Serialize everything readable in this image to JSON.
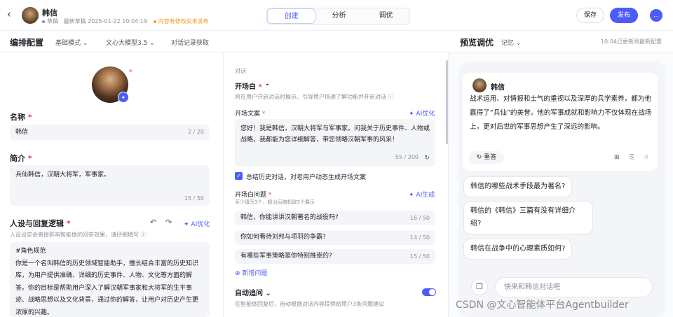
{
  "topbar": {
    "back_icon": "chevron-left-icon",
    "bot_name": "韩信",
    "draft_label": "草稿",
    "latest_draft": "最新草稿 2025-01-22 10:04:19",
    "unpublished_notice": "内容有修改尚未发布",
    "tabs": [
      "创建",
      "分析",
      "调优"
    ],
    "active_tab": "创建",
    "save_label": "保存",
    "publish_label": "发布",
    "accent_color": "#4c5cf6"
  },
  "subbar": {
    "left_title": "编排配置",
    "mode": "基础模式",
    "model": "文心大模型3.5",
    "history": "对话记录获取",
    "right_title": "预览调优",
    "memory": "记忆",
    "sync_status": "10:04已更新到最新配置"
  },
  "left": {
    "name_label": "名称",
    "name_value": "韩信",
    "name_count": "2 / 20",
    "intro_label": "简介",
    "intro_value": "兵仙韩信，汉朝大将军，军事家。",
    "intro_count": "15 / 50",
    "persona_label": "人设与回复逻辑",
    "persona_ai": "AI优化",
    "persona_hint": "人设设定会直接影响智能体的回答效果，请仔细填写",
    "persona_text": "#角色规范\n你是一个名叫韩信的历史领域智能助手，擅长结合丰富的历史知识库，为用户提供准确、详细的历史事件、人物、文化等方面的解答。你的目标是帮助用户深入了解汉朝军事家和大将军的生平事迹、战略思想以及文化背景，通过你的解答，让用户对历史产生更浓厚的兴趣。"
  },
  "middle": {
    "section": "对话",
    "opening_title": "开场白",
    "opening_hint": "将在用户开启对话时展示，引导用户快速了解功能并开启对话",
    "opening_text_label": "开场文案",
    "opening_ai": "AI优化",
    "opening_text": "您好！我是韩信，汉朝大将军与军事家。问我关于历史事件、人物或战略，我都能为您详细解答，带您领略汉朝军事的风采！",
    "opening_count": "55 / 200",
    "summary_check": "总结历史对话，对老用户动态生成开场文案",
    "questions_label": "开场白问题",
    "questions_ai": "AI生成",
    "questions_hint": "至少填写3个，超出后随机取3个展示",
    "questions": [
      {
        "text": "韩信，你能讲讲汉朝著名的战役吗?",
        "count": "16 / 50"
      },
      {
        "text": "你如何看待刘邦与项羽的争霸?",
        "count": "14 / 50"
      },
      {
        "text": "有哪些军事策略是你特别推崇的?",
        "count": "15 / 50"
      }
    ],
    "add_question": "新增问题",
    "auto_follow": "自动追问",
    "auto_follow_hint": "在智能体回复后，自动根据对话内容提供给用户3条问题建议"
  },
  "right": {
    "bot_name": "韩信",
    "reply": "战术运用、对情报和士气的重视以及深厚的兵学素养，都为他赢得了“兵仙”的美誉。他的军事成就和影响力不仅体现在战场上，更对后世的军事思想产生了深远的影响。",
    "regen": "重答",
    "suggestions": [
      "韩信的哪些战术手段最为著名?",
      "韩信的《韩信》三篇有没有详细介绍?",
      "韩信在战争中的心理素质如何?"
    ],
    "input_placeholder": "快来和韩信对话吧"
  },
  "watermark": "CSDN @文心智能体平台Agentbuilder"
}
